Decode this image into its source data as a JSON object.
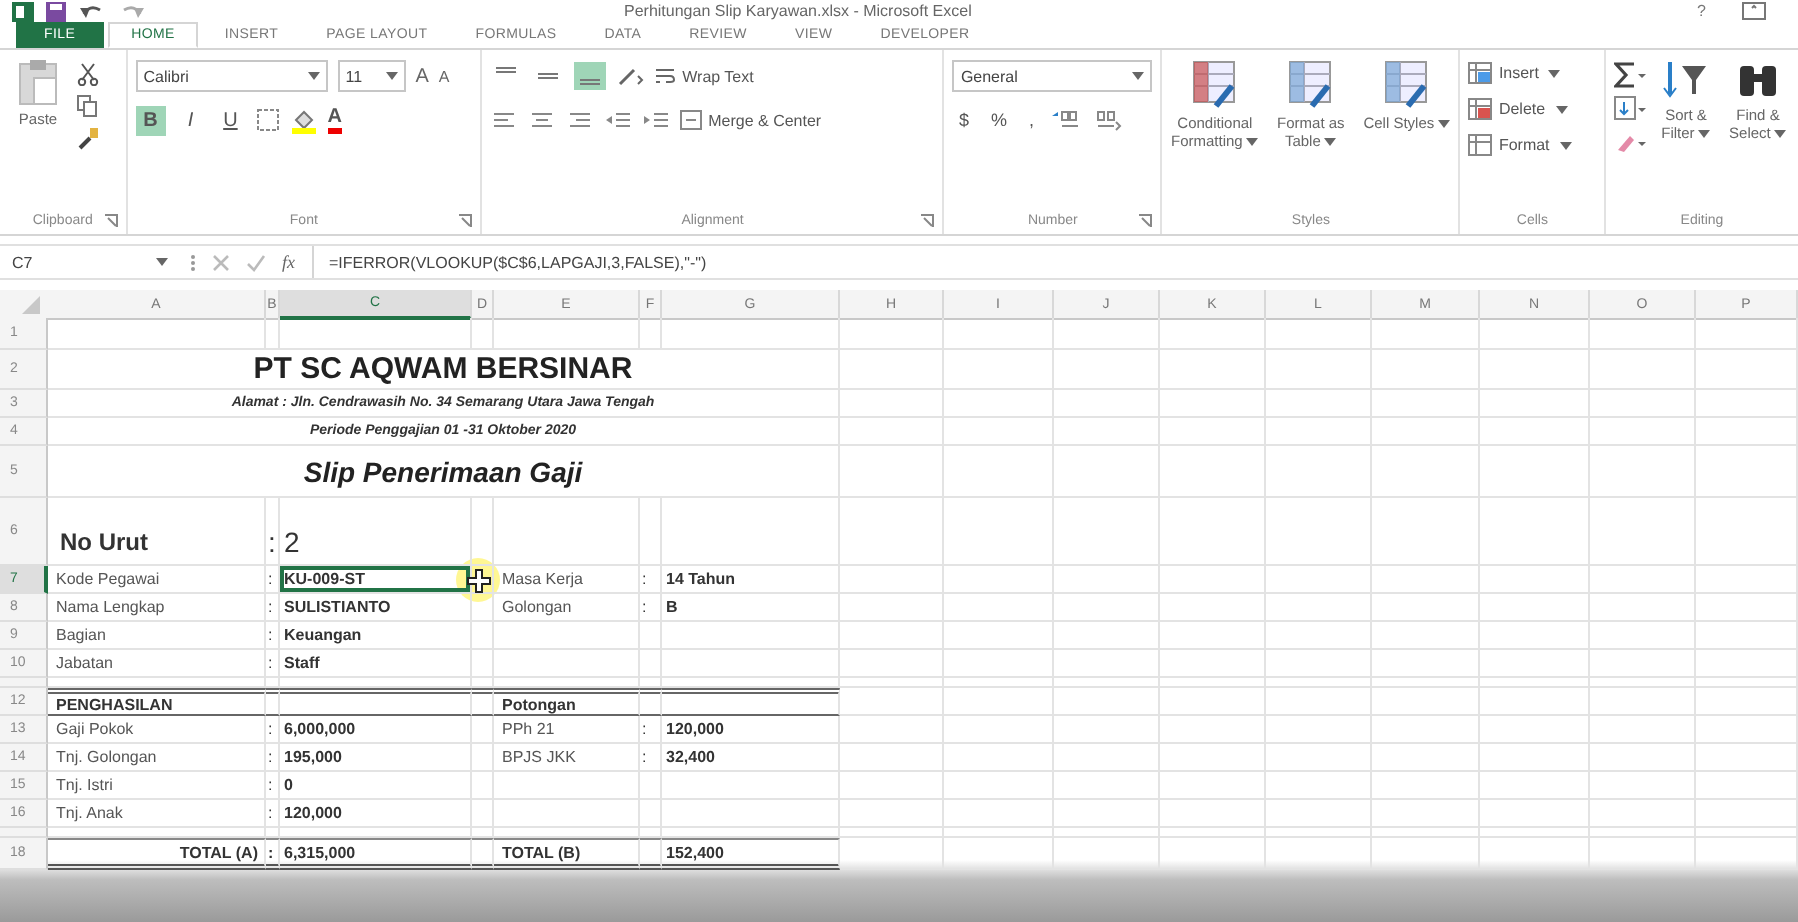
{
  "window": {
    "title": "Perhitungan Slip Karyawan.xlsx - Microsoft Excel",
    "help": "?"
  },
  "tabs": [
    {
      "label": "FILE",
      "kind": "file",
      "selected": false
    },
    {
      "label": "HOME",
      "kind": "tab",
      "selected": true
    },
    {
      "label": "INSERT",
      "kind": "tab",
      "selected": false
    },
    {
      "label": "PAGE LAYOUT",
      "kind": "tab",
      "selected": false
    },
    {
      "label": "FORMULAS",
      "kind": "tab",
      "selected": false
    },
    {
      "label": "DATA",
      "kind": "tab",
      "selected": false
    },
    {
      "label": "REVIEW",
      "kind": "tab",
      "selected": false
    },
    {
      "label": "VIEW",
      "kind": "tab",
      "selected": false
    },
    {
      "label": "DEVELOPER",
      "kind": "tab",
      "selected": false
    }
  ],
  "ribbon": {
    "groups": [
      {
        "kind": "clipboard",
        "label": "Clipboard",
        "paste": "Paste"
      },
      {
        "kind": "font",
        "label": "Font",
        "font_name": "Calibri",
        "font_size": "11",
        "size_buttons": [
          "A",
          "A"
        ],
        "format_buttons": [
          {
            "label": "B",
            "selected": true
          },
          {
            "label": "I",
            "selected": false
          },
          {
            "label": "U",
            "selected": false
          }
        ],
        "font_color": "A"
      },
      {
        "kind": "alignment",
        "label": "Alignment",
        "vertical_align": [
          {
            "selected": false
          },
          {
            "selected": false
          },
          {
            "selected": true
          }
        ],
        "wrap": "Wrap Text",
        "merge": "Merge & Center"
      },
      {
        "kind": "number",
        "label": "Number",
        "format": "General",
        "symbols": [
          "$",
          "%",
          ","
        ]
      },
      {
        "kind": "styles",
        "label": "Styles",
        "buttons": [
          "Conditional Formatting",
          "Format as Table",
          "Cell Styles"
        ]
      },
      {
        "kind": "cells",
        "label": "Cells",
        "buttons": [
          "Insert",
          "Delete",
          "Format"
        ]
      },
      {
        "kind": "editing",
        "label": "Editing",
        "buttons": [
          "Sort & Filter",
          "Find & Select"
        ]
      }
    ]
  },
  "formula_bar": {
    "name_box": "C7",
    "function_label": "fx",
    "formula": "=IFERROR(VLOOKUP($C$6,LAPGAJI,3,FALSE),\"-\")"
  },
  "columns": [
    {
      "label": "A",
      "selected": false
    },
    {
      "label": "B",
      "selected": false
    },
    {
      "label": "C",
      "selected": true
    },
    {
      "label": "D",
      "selected": false
    },
    {
      "label": "E",
      "selected": false
    },
    {
      "label": "F",
      "selected": false
    },
    {
      "label": "G",
      "selected": false
    },
    {
      "label": "H",
      "selected": false
    },
    {
      "label": "I",
      "selected": false
    },
    {
      "label": "J",
      "selected": false
    },
    {
      "label": "K",
      "selected": false
    },
    {
      "label": "L",
      "selected": false
    },
    {
      "label": "M",
      "selected": false
    },
    {
      "label": "N",
      "selected": false
    },
    {
      "label": "O",
      "selected": false
    },
    {
      "label": "P",
      "selected": false
    }
  ],
  "rows": [
    {
      "number": "1",
      "kind": "blank",
      "selected": false
    },
    {
      "number": "2",
      "kind": "title",
      "selected": false,
      "text": "PT SC AQWAM BERSINAR"
    },
    {
      "number": "3",
      "kind": "address",
      "selected": false,
      "text": "Alamat : Jln. Cendrawasih No. 34 Semarang Utara Jawa Tengah"
    },
    {
      "number": "4",
      "kind": "period",
      "selected": false,
      "text": "Periode Penggajian 01 -31 Oktober 2020"
    },
    {
      "number": "5",
      "kind": "slip",
      "selected": false,
      "text": "Slip Penerimaan Gaji"
    },
    {
      "number": "6",
      "kind": "no",
      "selected": false,
      "a": "No Urut",
      "b": ":",
      "c": "2"
    },
    {
      "number": "7",
      "kind": "field",
      "selected": true,
      "a": "Kode Pegawai",
      "b": ":",
      "c": "KU-009-ST",
      "e": "Masa Kerja",
      "f": ":",
      "g": "14 Tahun"
    },
    {
      "number": "8",
      "kind": "field",
      "selected": false,
      "a": "Nama Lengkap",
      "b": ":",
      "c": "SULISTIANTO",
      "e": "Golongan",
      "f": ":",
      "g": "B"
    },
    {
      "number": "9",
      "kind": "field",
      "selected": false,
      "a": "Bagian",
      "b": ":",
      "c": "Keuangan"
    },
    {
      "number": "10",
      "kind": "field",
      "selected": false,
      "a": "Jabatan",
      "b": ":",
      "c": "Staff"
    },
    {
      "kind": "spacer",
      "selected": false
    },
    {
      "number": "12",
      "kind": "header",
      "selected": false,
      "a": "PENGHASILAN",
      "e": "Potongan"
    },
    {
      "number": "13",
      "kind": "field",
      "selected": false,
      "a": "Gaji Pokok",
      "b": ":",
      "c": "6,000,000",
      "e": "PPh 21",
      "f": ":",
      "g": "120,000"
    },
    {
      "number": "14",
      "kind": "field",
      "selected": false,
      "a": "Tnj. Golongan",
      "b": ":",
      "c": "195,000",
      "e": "BPJS JKK",
      "f": ":",
      "g": "32,400"
    },
    {
      "number": "15",
      "kind": "field",
      "selected": false,
      "a": "Tnj. Istri",
      "b": ":",
      "c": "0"
    },
    {
      "number": "16",
      "kind": "field",
      "selected": false,
      "a": "Tnj. Anak",
      "b": ":",
      "c": "120,000"
    },
    {
      "kind": "spacer",
      "selected": false
    },
    {
      "number": "18",
      "kind": "total",
      "selected": false,
      "total_a_label": "TOTAL (A)",
      "total_a_colon": ":",
      "total_a_value": "6,315,000",
      "total_b_label": "TOTAL (B)",
      "total_b_value": "152,400"
    }
  ]
}
